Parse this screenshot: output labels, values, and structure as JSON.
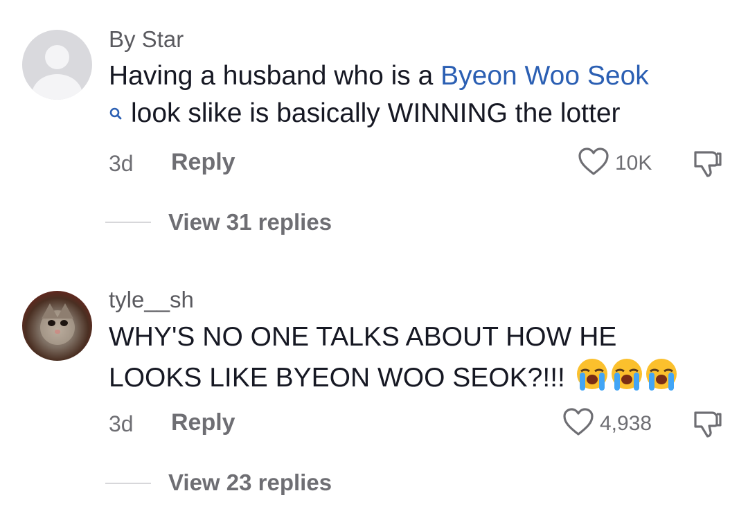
{
  "comments": [
    {
      "username": "By Star",
      "text_part1": "Having a husband who is a ",
      "link_text": "Byeon Woo Seok",
      "text_part2": "look slike is basically WINNING the lotter",
      "time": "3d",
      "reply_label": "Reply",
      "likes": "10K",
      "view_replies": "View 31 replies",
      "avatar_icon": "default-user-avatar"
    },
    {
      "username": "tyle__sh",
      "text_line1": "WHY'S NO ONE TALKS ABOUT HOW HE",
      "text_line2": "LOOKS LIKE BYEON WOO SEOK?!!!",
      "emojis": "😭😭😭",
      "time": "3d",
      "reply_label": "Reply",
      "likes": "4,938",
      "view_replies": "View 23 replies",
      "avatar_icon": "kitten-photo-avatar"
    }
  ],
  "colors": {
    "link": "#2b5fb3",
    "text": "#161823",
    "secondary": "#6e6e73"
  },
  "icons": [
    "heart-icon",
    "dislike-icon",
    "search-icon",
    "loudly-crying-face-emoji"
  ]
}
